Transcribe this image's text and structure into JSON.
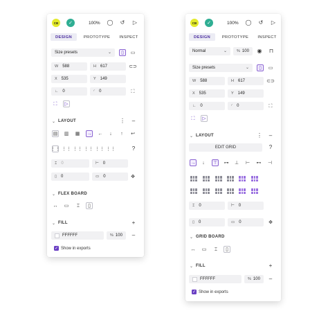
{
  "left_panel": {
    "header": {
      "avatar_initials": "CB",
      "zoom": "100%"
    },
    "tabs": [
      "DESIGN",
      "PROTOTYPE",
      "INSPECT"
    ],
    "size_presets": "Size presets",
    "w_label": "W",
    "w_value": "588",
    "h_label": "H",
    "h_value": "617",
    "x_label": "X",
    "x_value": "535",
    "y_label": "Y",
    "y_value": "149",
    "rotation": "0",
    "radius": "0",
    "layout_title": "LAYOUT",
    "gap_row": "0",
    "gap_col": "0",
    "pad_v": "0",
    "pad_h": "0",
    "flex_board_title": "FLEX BOARD",
    "fill_title": "FILL",
    "fill_hex": "FFFFFF",
    "fill_opacity": "100",
    "pct": "%",
    "show_in_exports": "Show in exports"
  },
  "right_panel": {
    "header": {
      "avatar_initials": "CB",
      "zoom": "100%"
    },
    "tabs": [
      "DESIGN",
      "PROTOTYPE",
      "INSPECT"
    ],
    "blend_mode": "Normal",
    "layer_opacity": "100",
    "pct": "%",
    "size_presets": "Size presets",
    "w_label": "W",
    "w_value": "588",
    "h_label": "H",
    "h_value": "617",
    "x_label": "X",
    "x_value": "535",
    "y_label": "Y",
    "y_value": "149",
    "rotation": "0",
    "radius": "0",
    "layout_title": "LAYOUT",
    "edit_grid": "EDIT GRID",
    "gap_row": "0",
    "gap_col": "0",
    "pad_v": "0",
    "pad_h": "0",
    "grid_board_title": "GRID BOARD",
    "fill_title": "FILL",
    "fill_hex": "FFFFFF",
    "fill_opacity": "100",
    "show_in_exports": "Show in exports"
  },
  "colors": {
    "accent": "#6a3fc3",
    "avatar": "#e3ea2b",
    "check": "#2fae93",
    "field_bg": "#f1f1f3"
  }
}
